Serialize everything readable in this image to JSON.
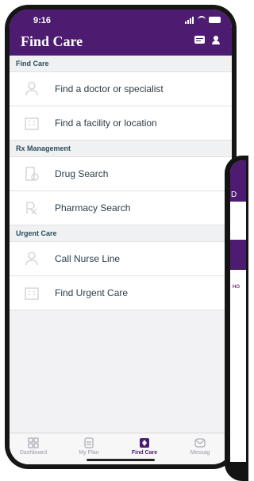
{
  "status": {
    "time": "9:16"
  },
  "header": {
    "title": "Find Care"
  },
  "sections": [
    {
      "title": "Find Care",
      "items": [
        {
          "label": "Find a doctor or specialist",
          "icon": "doctor-icon"
        },
        {
          "label": "Find a facility or location",
          "icon": "building-icon"
        }
      ]
    },
    {
      "title": "Rx Management",
      "items": [
        {
          "label": "Drug Search",
          "icon": "pill-bottle-icon"
        },
        {
          "label": "Pharmacy Search",
          "icon": "rx-icon"
        }
      ]
    },
    {
      "title": "Urgent Care",
      "items": [
        {
          "label": "Call Nurse Line",
          "icon": "nurse-icon"
        },
        {
          "label": "Find Urgent Care",
          "icon": "building-icon"
        }
      ]
    }
  ],
  "tabs": [
    {
      "label": "Dashboard",
      "icon": "dashboard-icon"
    },
    {
      "label": "My Plan",
      "icon": "plan-icon"
    },
    {
      "label": "Find Care",
      "icon": "find-care-icon",
      "active": true
    },
    {
      "label": "Messag",
      "icon": "message-icon"
    }
  ],
  "overlay": {
    "header_text": "D",
    "subtitle": "HO"
  },
  "colors": {
    "accent": "#4d1c70",
    "section_text": "#2a4d5c",
    "item_text": "#2d3c48"
  }
}
